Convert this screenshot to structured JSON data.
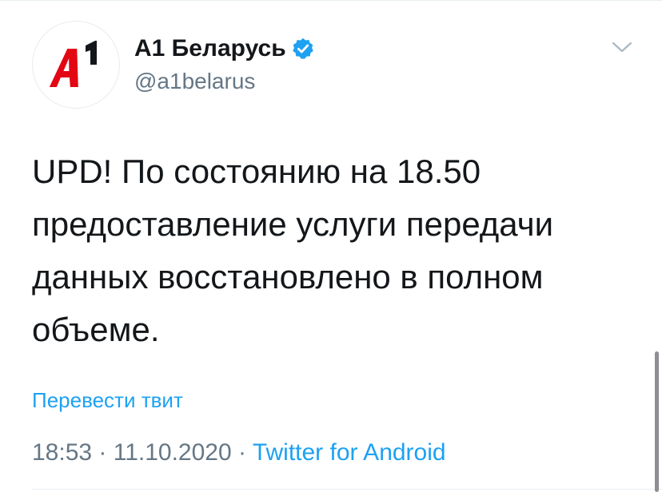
{
  "tweet": {
    "author": {
      "display_name": "A1 Беларусь",
      "handle": "@a1belarus",
      "verified": true,
      "avatar_icon": "a1-logo-icon",
      "avatar_logo_text": "A1",
      "brand_color": "#e30613"
    },
    "text_lines": [
      "UPD! По состоянию на 18.50",
      "предоставление услуги передачи",
      "данных восстановлено в полном",
      "объеме."
    ],
    "translate_label": "Перевести твит",
    "time": "18:53",
    "separator": "·",
    "date": "11.10.2020",
    "source": "Twitter for Android"
  },
  "icons": {
    "verified": "verified-badge-icon",
    "menu": "chevron-down-icon"
  },
  "colors": {
    "link": "#1da1f2",
    "muted": "#657786",
    "text": "#14171a",
    "divider": "#e6ecf0"
  }
}
